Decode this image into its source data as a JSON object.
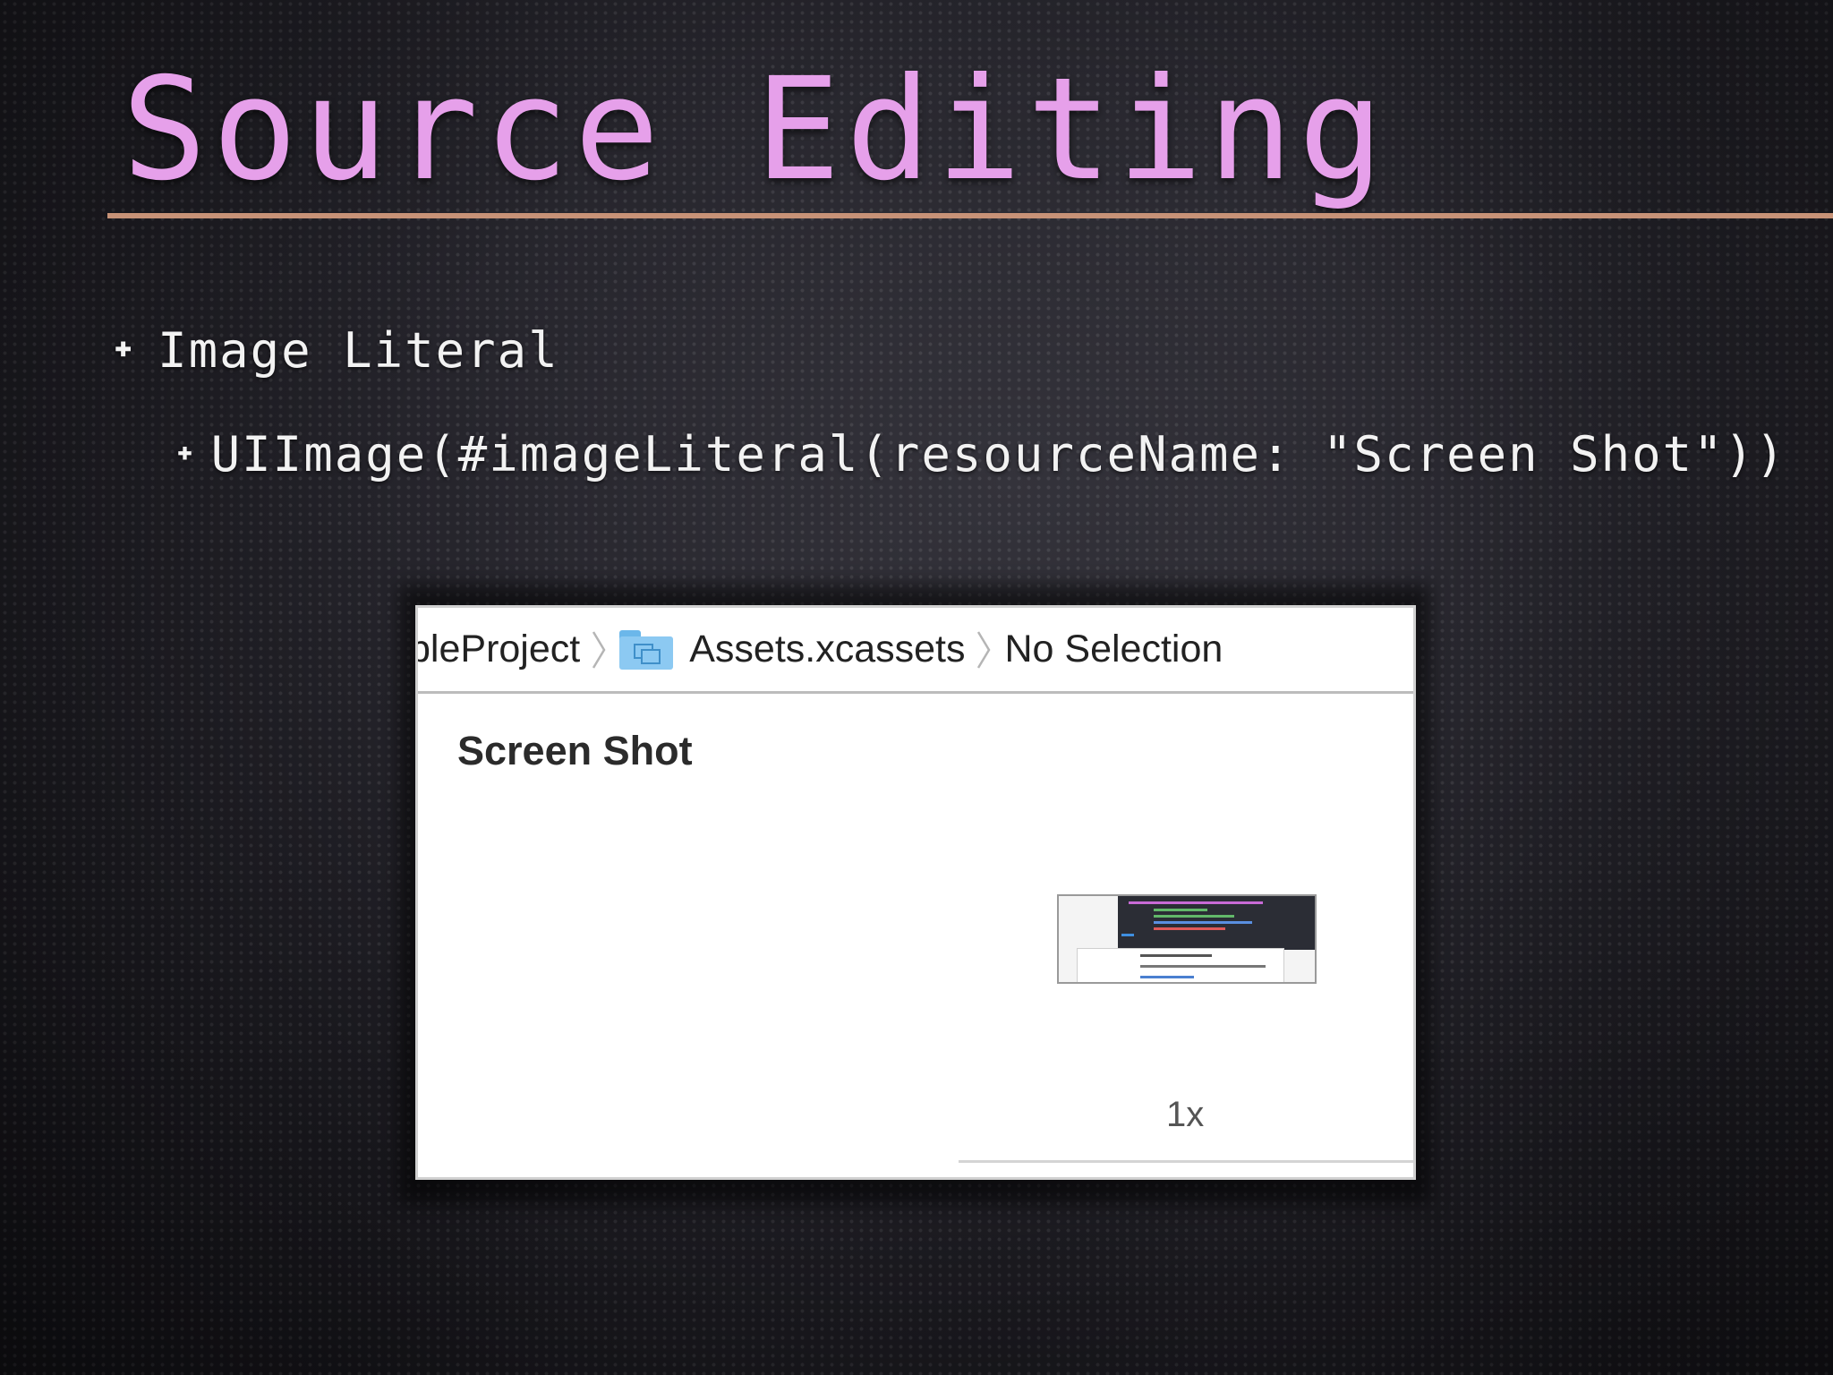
{
  "slide": {
    "title": "Source Editing",
    "bullets": [
      {
        "text": "Image Literal"
      },
      {
        "text": "UIImage(#imageLiteral(resourceName: \"Screen Shot\"))"
      }
    ]
  },
  "screenshot": {
    "breadcrumb": {
      "project": "pleProject",
      "catalog": "Assets.xcassets",
      "selection": "No Selection"
    },
    "asset_name": "Screen Shot",
    "scale_label": "1x"
  },
  "colors": {
    "title": "#e6a0ea",
    "rule": "#c79277",
    "folder": "#8cc9f2"
  }
}
